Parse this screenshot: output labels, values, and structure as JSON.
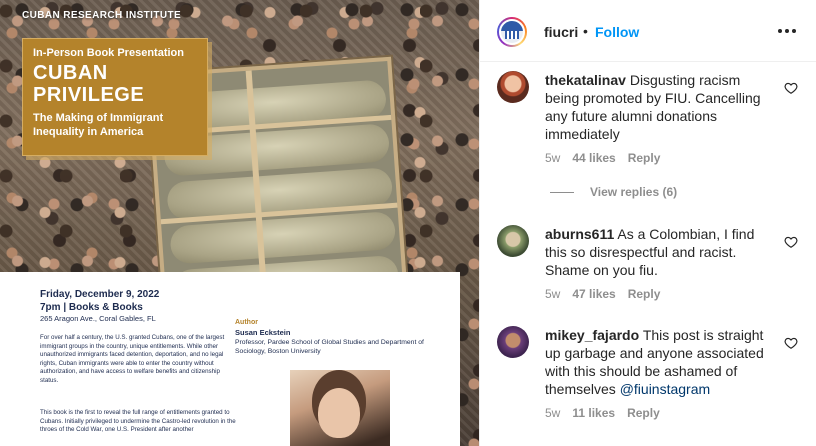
{
  "post": {
    "org": "CUBAN RESEARCH INSTITUTE",
    "kicker": "In-Person Book Presentation",
    "title_line1": "CUBAN",
    "title_line2": "PRIVILEGE",
    "subtitle": "The Making of Immigrant Inequality in America",
    "event_date": "Friday, December 9, 2022",
    "event_time": "7pm | Books & Books",
    "event_address": "265 Aragon Ave., Coral Gables, FL",
    "body_paragraph_1": "For over half a century, the U.S. granted Cubans, one of the largest immigrant groups in the country, unique entitlements. While other unauthorized immigrants faced detention, deportation, and no legal rights, Cuban immigrants were able to enter the country without authorization, and have access to welfare benefits and citizenship status.",
    "body_paragraph_2": "This book is the first to reveal the full range of entitlements granted to Cubans. Initially privileged to undermine the Castro-led revolution in the throes of the Cold War, one U.S. President after another",
    "author_heading": "Author",
    "author_name": "Susan Eckstein",
    "author_affiliation": "Professor, Pardee School of Global Studies and Department of Sociology, Boston University"
  },
  "header": {
    "username": "fiucri",
    "separator": "•",
    "follow_label": "Follow",
    "more_icon": "more-horizontal-icon"
  },
  "comments": [
    {
      "username": "thekatalinav",
      "text": "Disgusting racism being promoted by FIU. Cancelling any future alumni donations immediately",
      "age": "5w",
      "likes": "44 likes",
      "reply_label": "Reply"
    },
    {
      "username": "aburns611",
      "text": "As a Colombian, I find this so disrespectful and racist. Shame on you fiu.",
      "age": "5w",
      "likes": "47 likes",
      "reply_label": "Reply"
    },
    {
      "username": "mikey_fajardo",
      "text": "This post is straight up garbage and anyone associated with this should be ashamed of themselves",
      "mention": "@fiuinstagram",
      "age": "5w",
      "likes": "11 likes",
      "reply_label": "Reply"
    }
  ],
  "view_replies": "View replies (6)",
  "colors": {
    "accent_blue": "#0095f6",
    "title_box_gold": "#b4832b",
    "muted_text": "#8e8e8e",
    "mention": "#00376b"
  }
}
